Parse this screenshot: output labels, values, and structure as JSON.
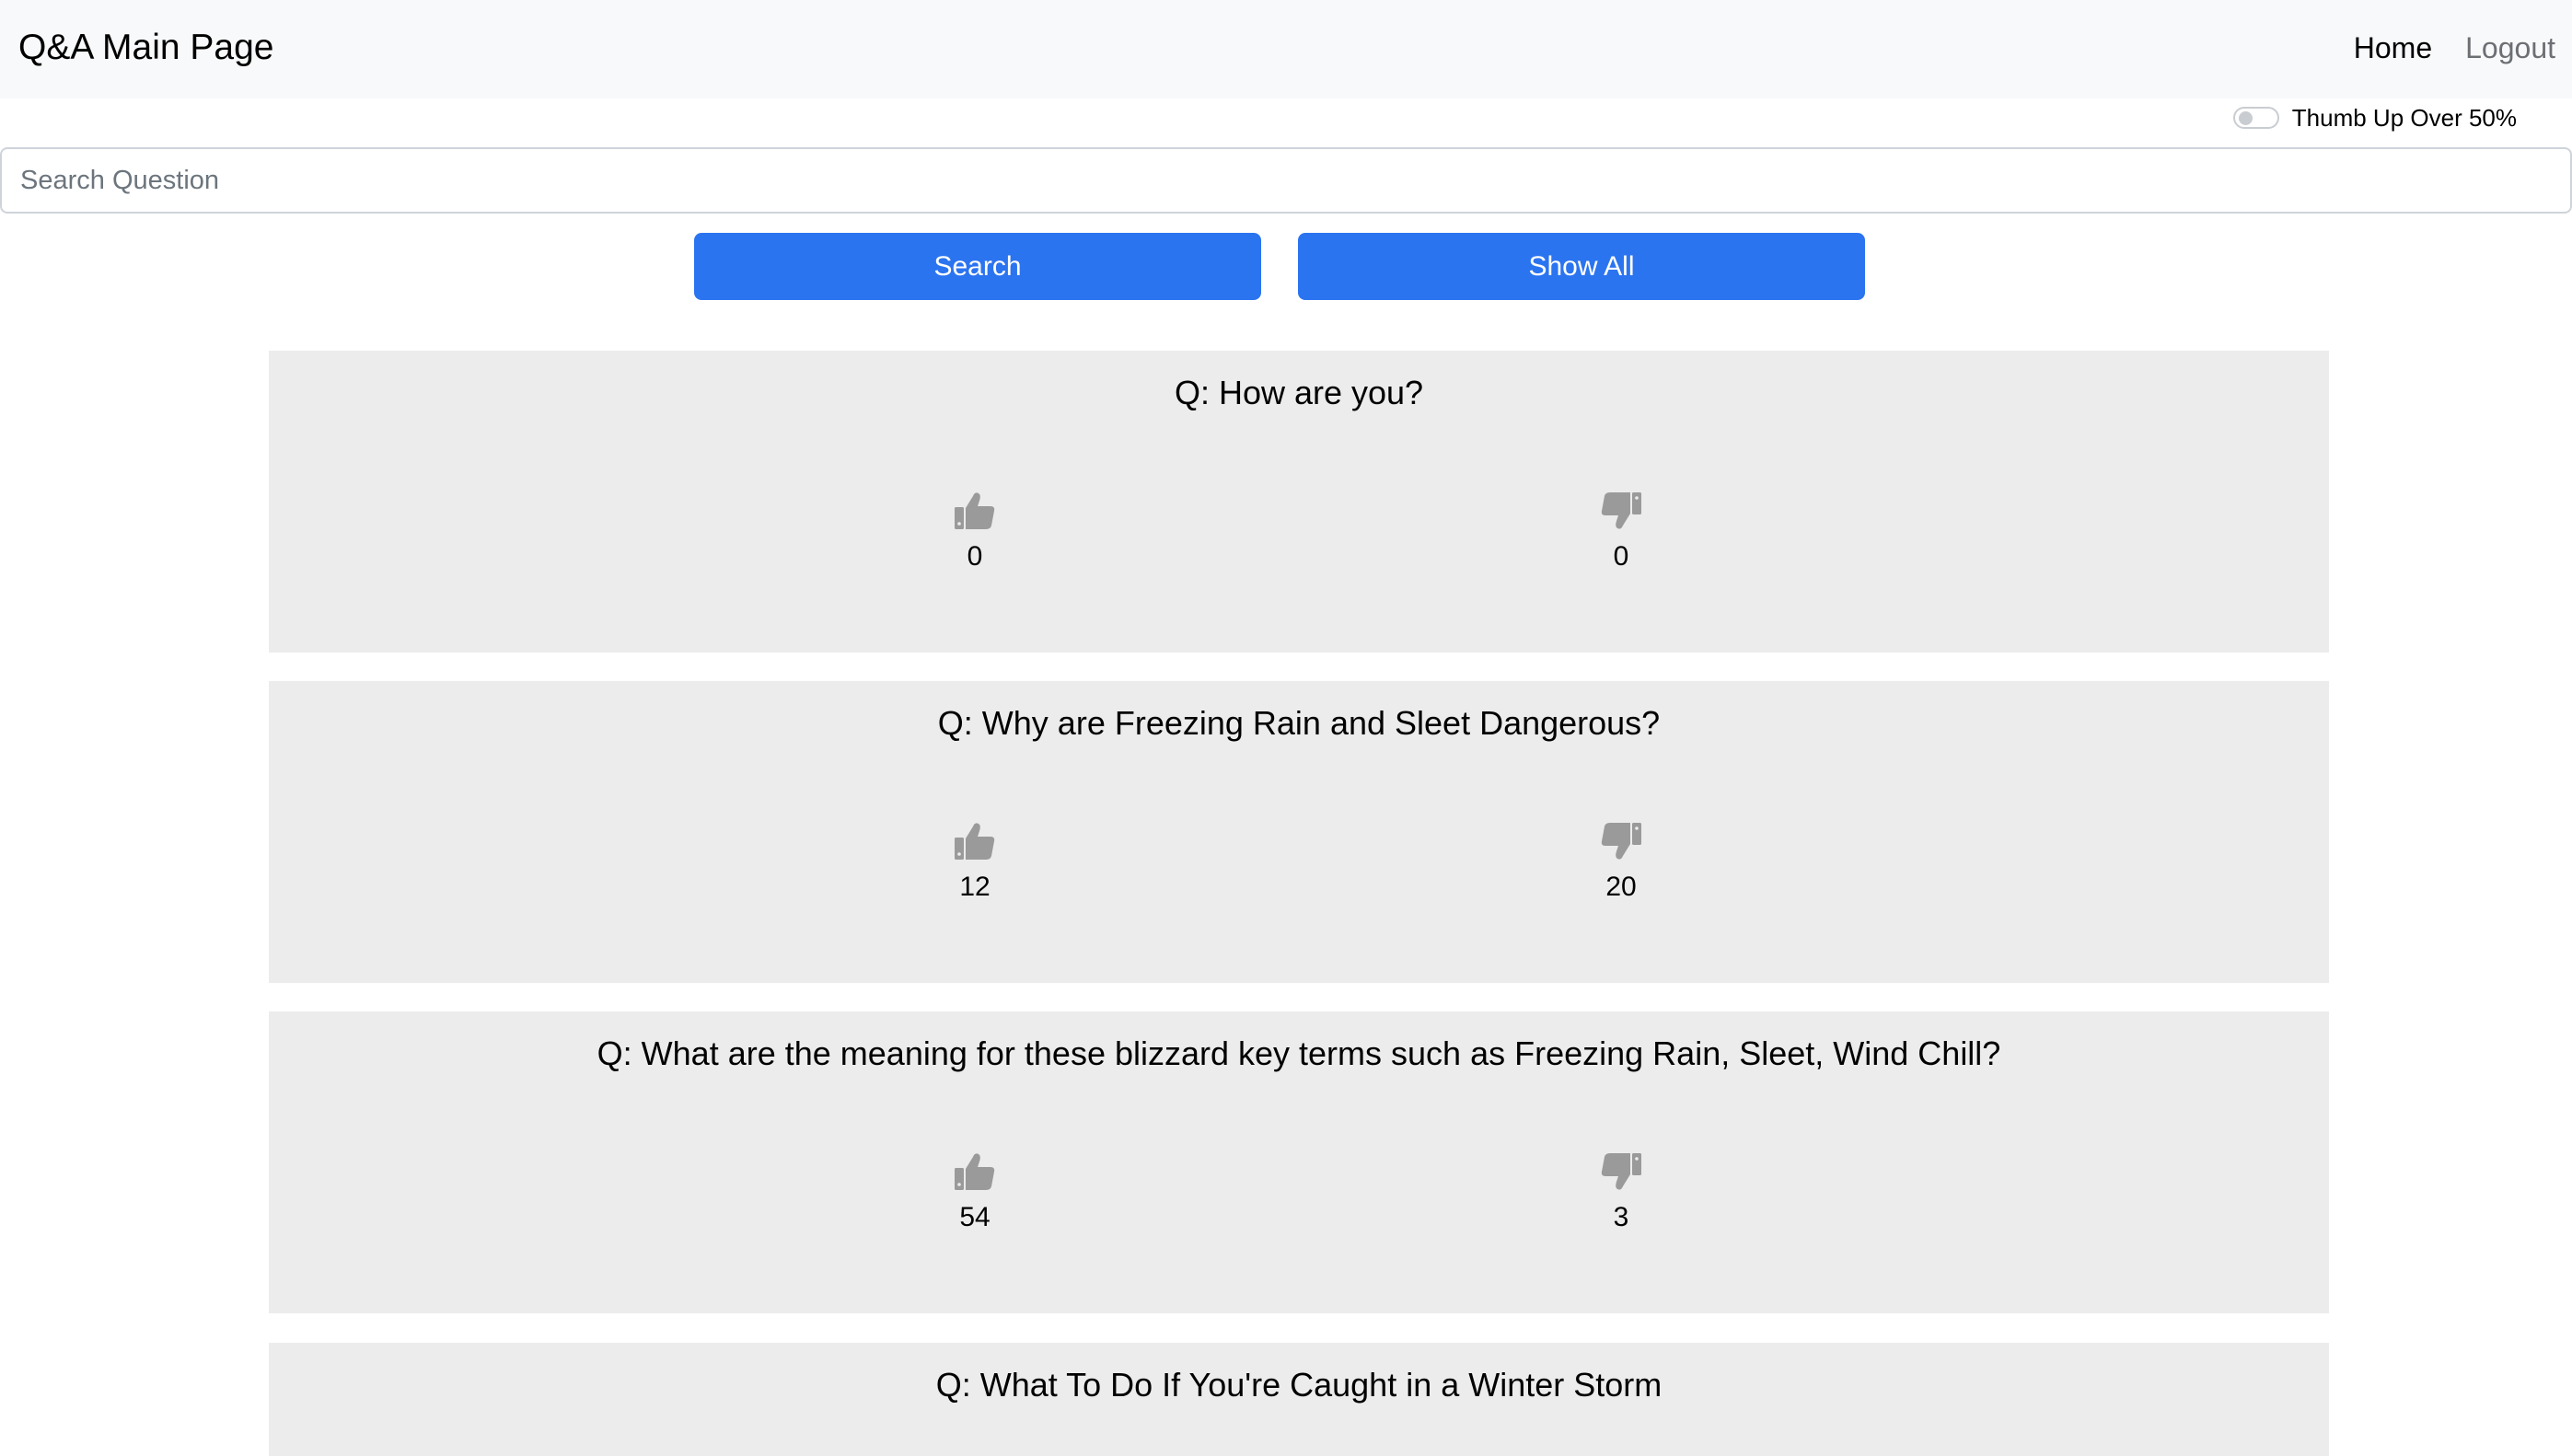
{
  "navbar": {
    "brand": "Q&A Main Page",
    "links": [
      {
        "label": "Home"
      },
      {
        "label": "Logout"
      }
    ]
  },
  "filter": {
    "toggle_label": "Thumb Up Over 50%",
    "toggle_on": false
  },
  "search": {
    "placeholder": "Search Question",
    "value": "",
    "search_label": "Search",
    "show_all_label": "Show All"
  },
  "questions": [
    {
      "title": "Q: How are you?",
      "thumbs_up": "0",
      "thumbs_down": "0"
    },
    {
      "title": "Q: Why are Freezing Rain and Sleet Dangerous?",
      "thumbs_up": "12",
      "thumbs_down": "20"
    },
    {
      "title": "Q: What are the meaning for these blizzard key terms such as Freezing Rain, Sleet, Wind Chill?",
      "thumbs_up": "54",
      "thumbs_down": "3"
    },
    {
      "title": "Q: What To Do If You're Caught in a Winter Storm",
      "thumbs_up": "",
      "thumbs_down": ""
    }
  ],
  "colors": {
    "primary": "#2b74f0",
    "navbar_bg": "#f8f9fa",
    "card_bg": "#ececec",
    "icon": "#9a9a9a"
  },
  "icons": {
    "thumbs_up": "thumbs-up-icon",
    "thumbs_down": "thumbs-down-icon"
  }
}
